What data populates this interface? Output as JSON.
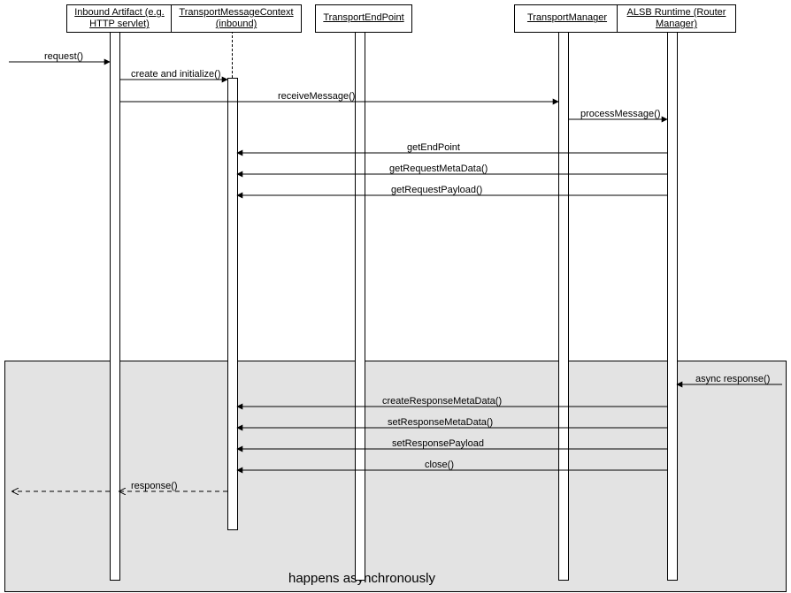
{
  "actors": {
    "a1": "Inbound Artifact (e.g. HTTP servlet)",
    "a2": "TransportMessageContext (inbound)",
    "a3": "TransportEndPoint",
    "a4": "TransportManager",
    "a5": "ALSB Runtime (Router Manager)"
  },
  "messages": {
    "request": "request()",
    "createInit": "create and initialize()",
    "receiveMessage": "receiveMessage()",
    "processMessage": "processMessage()",
    "getEndPoint": "getEndPoint",
    "getRequestMetaData": "getRequestMetaData()",
    "getRequestPayload": "getRequestPayload()",
    "asyncResponse": "async response()",
    "createResponseMetaData": "createResponseMetaData()",
    "setResponseMetaData": "setResponseMetaData()",
    "setResponsePayload": "setResponsePayload",
    "close": "close()",
    "response": "response()"
  },
  "regionLabel": "happens asynchronously"
}
